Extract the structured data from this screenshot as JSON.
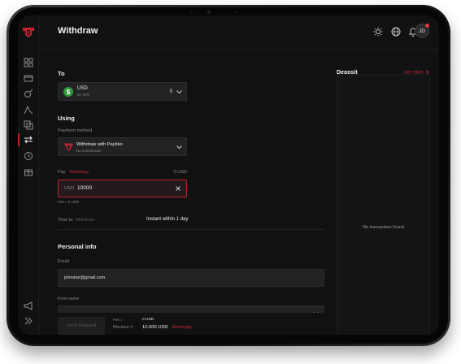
{
  "header": {
    "title": "Withdraw",
    "avatar_initials": "JD"
  },
  "to_section": {
    "title": "To",
    "currency": "USD",
    "account_id": "ID: 879",
    "balance": "0"
  },
  "using_section": {
    "title": "Using",
    "payment_method_label": "Payment method",
    "method_name": "Withdraw with Paytiko",
    "method_note": "No commission"
  },
  "pay": {
    "label": "Pay",
    "summary_link": "Summary",
    "available": "0 USD",
    "currency_prefix": "USD",
    "amount_value": "10000",
    "fee_note": "Fee = 0 USD"
  },
  "time_row": {
    "label": "Time to",
    "label_suffix": "Withdraw",
    "value": "Instant within 1 day"
  },
  "personal_info": {
    "title": "Personal info",
    "email_label": "Email",
    "email_value": "johndoe@gmail.com",
    "first_name_label": "First name"
  },
  "footer": {
    "send_button": "Send Request",
    "fee_label": "Fee =",
    "fee_value": "0 USD",
    "receive_label": "Receive =",
    "receive_value": "10.000 USD",
    "summary_link": "Summary"
  },
  "deposit": {
    "title": "Deposit",
    "see_more": "See More",
    "empty_text": "No transaction found"
  },
  "colors": {
    "accent": "#d9293a",
    "background": "#111112",
    "field": "#222224",
    "currency_badge": "#2c9a3c"
  }
}
